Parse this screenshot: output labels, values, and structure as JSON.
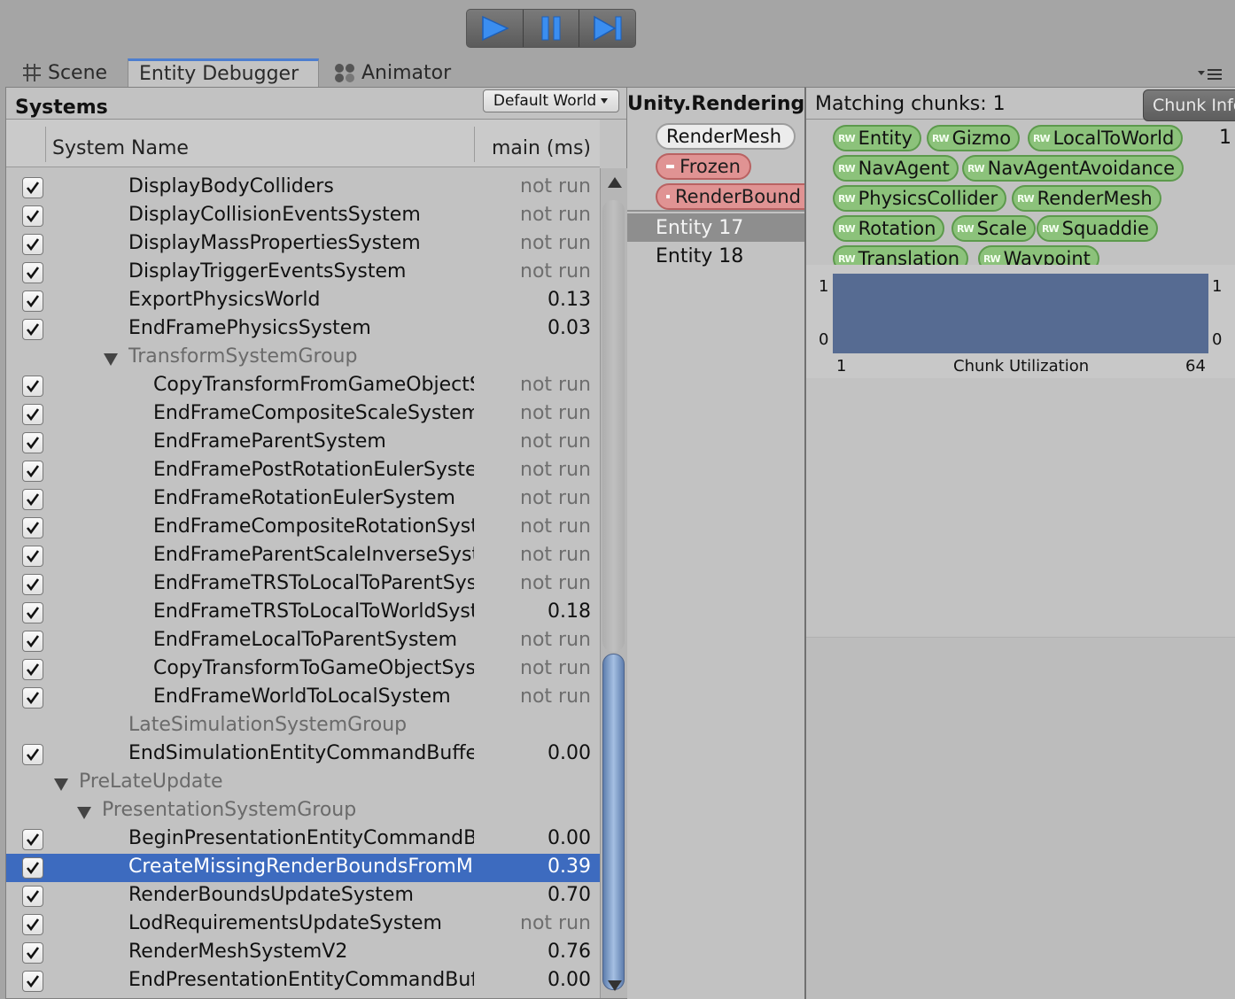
{
  "toolbar": {
    "play": "play-icon",
    "pause": "pause-icon",
    "step": "step-icon"
  },
  "tabs": [
    {
      "label": "Scene",
      "icon": "grid-icon"
    },
    {
      "label": "Entity Debugger",
      "icon": ""
    },
    {
      "label": "Animator",
      "icon": "animator-icon"
    }
  ],
  "systems": {
    "title": "Systems",
    "world": "Default World",
    "col_name": "System Name",
    "col_ms": "main (ms)",
    "rows": [
      {
        "label": "DisplayBodyColliders",
        "ms": "not run",
        "checked": true,
        "indent": 2
      },
      {
        "label": "DisplayCollisionEventsSystem",
        "ms": "not run",
        "checked": true,
        "indent": 2
      },
      {
        "label": "DisplayMassPropertiesSystem",
        "ms": "not run",
        "checked": true,
        "indent": 2
      },
      {
        "label": "DisplayTriggerEventsSystem",
        "ms": "not run",
        "checked": true,
        "indent": 2
      },
      {
        "label": "ExportPhysicsWorld",
        "ms": "0.13",
        "checked": true,
        "indent": 2
      },
      {
        "label": "EndFramePhysicsSystem",
        "ms": "0.03",
        "checked": true,
        "indent": 2
      },
      {
        "label": "TransformSystemGroup",
        "ms": "",
        "checked": false,
        "group": true,
        "indent": 2
      },
      {
        "label": "CopyTransformFromGameObjectS",
        "ms": "not run",
        "checked": true,
        "indent": 3
      },
      {
        "label": "EndFrameCompositeScaleSystem",
        "ms": "not run",
        "checked": true,
        "indent": 3
      },
      {
        "label": "EndFrameParentSystem",
        "ms": "not run",
        "checked": true,
        "indent": 3
      },
      {
        "label": "EndFramePostRotationEulerSysten",
        "ms": "not run",
        "checked": true,
        "indent": 3
      },
      {
        "label": "EndFrameRotationEulerSystem",
        "ms": "not run",
        "checked": true,
        "indent": 3
      },
      {
        "label": "EndFrameCompositeRotationSyste",
        "ms": "not run",
        "checked": true,
        "indent": 3
      },
      {
        "label": "EndFrameParentScaleInverseSyster",
        "ms": "not run",
        "checked": true,
        "indent": 3
      },
      {
        "label": "EndFrameTRSToLocalToParentSyst",
        "ms": "not run",
        "checked": true,
        "indent": 3
      },
      {
        "label": "EndFrameTRSToLocalToWorldSyst",
        "ms": "0.18",
        "checked": true,
        "indent": 3
      },
      {
        "label": "EndFrameLocalToParentSystem",
        "ms": "not run",
        "checked": true,
        "indent": 3
      },
      {
        "label": "CopyTransformToGameObjectSys",
        "ms": "not run",
        "checked": true,
        "indent": 3
      },
      {
        "label": "EndFrameWorldToLocalSystem",
        "ms": "not run",
        "checked": true,
        "indent": 3
      },
      {
        "label": "LateSimulationSystemGroup",
        "ms": "",
        "checked": false,
        "group": true,
        "noarrow": true,
        "indent": 2
      },
      {
        "label": "EndSimulationEntityCommandBuffer",
        "ms": "0.00",
        "checked": true,
        "indent": 2
      },
      {
        "label": "PreLateUpdate",
        "ms": "",
        "checked": false,
        "group": true,
        "indent": 0
      },
      {
        "label": "PresentationSystemGroup",
        "ms": "",
        "checked": false,
        "group": true,
        "indent": 1
      },
      {
        "label": "BeginPresentationEntityCommandBu",
        "ms": "0.00",
        "checked": true,
        "indent": 2
      },
      {
        "label": "CreateMissingRenderBoundsFromMe",
        "ms": "0.39",
        "checked": true,
        "indent": 2,
        "selected": true
      },
      {
        "label": "RenderBoundsUpdateSystem",
        "ms": "0.70",
        "checked": true,
        "indent": 2
      },
      {
        "label": "LodRequirementsUpdateSystem",
        "ms": "not run",
        "checked": true,
        "indent": 2
      },
      {
        "label": "RenderMeshSystemV2",
        "ms": "0.76",
        "checked": true,
        "indent": 2
      },
      {
        "label": "EndPresentationEntityCommandBuffe",
        "ms": "0.00",
        "checked": true,
        "indent": 2
      }
    ]
  },
  "query": {
    "title": "Unity.Rendering.C",
    "filters": [
      {
        "label": "RenderMesh",
        "kind": "white"
      },
      {
        "label": "Frozen",
        "kind": "red"
      },
      {
        "label": "RenderBound",
        "kind": "red"
      }
    ],
    "entities": [
      {
        "label": "Entity 17",
        "selected": true
      },
      {
        "label": "Entity 18",
        "selected": false
      }
    ]
  },
  "chunks": {
    "matching": "Matching chunks: 1",
    "info_button": "Chunk Info",
    "count": "1",
    "components": [
      [
        "Entity",
        "Gizmo",
        "LocalToWorld"
      ],
      [
        "NavAgent",
        "NavAgentAvoidance"
      ],
      [
        "PhysicsCollider",
        "RenderMesh"
      ],
      [
        "Rotation",
        "Scale",
        "Squaddie"
      ],
      [
        "Translation",
        "Waypoint"
      ]
    ],
    "rw_tag": "RW",
    "chart": {
      "ymax_left": "1",
      "ymin_left": "0",
      "ymax_right": "1",
      "ymin_right": "0",
      "xmin": "1",
      "xmax": "64",
      "xlabel": "Chunk Utilization",
      "fill": 1.0
    }
  },
  "colors": {
    "accent": "#3d6bbf",
    "tag_green": "#8cc27b",
    "tag_red": "#e09393",
    "bar": "#566b92"
  }
}
